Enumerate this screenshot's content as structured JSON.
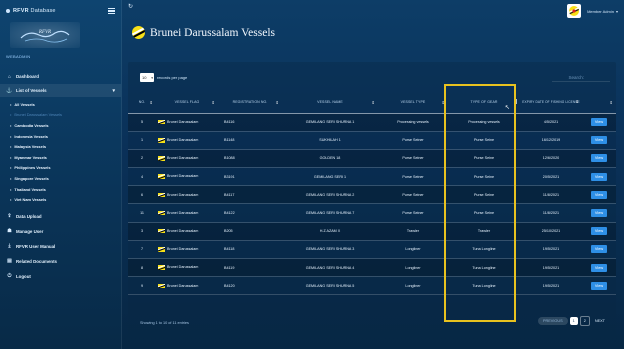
{
  "app": {
    "brand_bold": "RFVR",
    "brand_light": "Database",
    "logo_text": "RFVR",
    "sidebar_user": "WEBADMIN"
  },
  "sidebar": {
    "items": [
      {
        "label": "Dashboard",
        "icon": "home-icon"
      },
      {
        "label": "List of Vessels",
        "icon": "anchor-icon"
      }
    ],
    "sub_items": [
      {
        "label": "All Vessels"
      },
      {
        "label": "Brunei Darussalam Vessels",
        "active": true
      },
      {
        "label": "Cambodia Vessels"
      },
      {
        "label": "Indonesia Vessels"
      },
      {
        "label": "Malaysia Vessels"
      },
      {
        "label": "Myanmar Vessels"
      },
      {
        "label": "Philippines Vessels"
      },
      {
        "label": "Singapore Vessels"
      },
      {
        "label": "Thailand Vessels"
      },
      {
        "label": "Viet Nam Vessels"
      }
    ],
    "bottom_items": [
      {
        "label": "Data Upload",
        "icon": "upload-icon"
      },
      {
        "label": "Manage User",
        "icon": "users-icon"
      },
      {
        "label": "RFVR User Manual",
        "icon": "download-icon"
      },
      {
        "label": "Related Documents",
        "icon": "document-icon"
      },
      {
        "label": "Logout",
        "icon": "power-icon"
      }
    ]
  },
  "header": {
    "title": "Brunei Darussalam Vessels",
    "user_name": "Member Admin"
  },
  "controls": {
    "page_length": "10",
    "length_label": "records per page",
    "search_label": "Search:",
    "search_placeholder": ""
  },
  "table": {
    "columns": [
      "NO.",
      "VESSEL FLAG",
      "REGISTRATION NO.",
      "VESSEL NAME",
      "VESSEL TYPE",
      "TYPE OF GEAR",
      "EXPIRY DATE OF FISHING LICENSE",
      ""
    ],
    "rows": [
      {
        "no": "5",
        "flag": "Brunei Darussalam",
        "reg": "B4116",
        "name": "GEMILANG SERI SHURNA 1",
        "type": "Processing vessels",
        "gear": "Processing vessels",
        "expiry": "4/5/2021",
        "action": "View"
      },
      {
        "no": "1",
        "flag": "Brunei Darussalam",
        "reg": "B1148",
        "name": "SUKHILAH 1",
        "type": "Purse Seiner",
        "gear": "Purse Seine",
        "expiry": "16/12/2019",
        "action": "View"
      },
      {
        "no": "2",
        "flag": "Brunei Darussalam",
        "reg": "B1088",
        "name": "GOLDEN 18",
        "type": "Purse Seiner",
        "gear": "Purse Seine",
        "expiry": "12/6/2020",
        "action": "View"
      },
      {
        "no": "4",
        "flag": "Brunei Darussalam",
        "reg": "B3191",
        "name": "GEMILANG SERI 1",
        "type": "Purse Seiner",
        "gear": "Purse Seine",
        "expiry": "20/5/2021",
        "action": "View"
      },
      {
        "no": "6",
        "flag": "Brunei Darussalam",
        "reg": "B4117",
        "name": "GEMILANG SERI SHURNA 2",
        "type": "Purse Seiner",
        "gear": "Purse Seine",
        "expiry": "11/8/2021",
        "action": "View"
      },
      {
        "no": "11",
        "flag": "Brunei Darussalam",
        "reg": "B4122",
        "name": "GEMILANG SERI SHURNA 7",
        "type": "Purse Seiner",
        "gear": "Purse Seine",
        "expiry": "11/8/2021",
        "action": "View"
      },
      {
        "no": "3",
        "flag": "Brunei Darussalam",
        "reg": "B205",
        "name": "H.Z AZAM X",
        "type": "Trawler",
        "gear": "Trawler",
        "expiry": "25/10/2021",
        "action": "View"
      },
      {
        "no": "7",
        "flag": "Brunei Darussalam",
        "reg": "B4118",
        "name": "GEMILANG SERI SHURNA 3",
        "type": "Longliner",
        "gear": "Tuna Longline",
        "expiry": "19/5/2021",
        "action": "View"
      },
      {
        "no": "8",
        "flag": "Brunei Darussalam",
        "reg": "B4119",
        "name": "GEMILANG SERI SHURNA 4",
        "type": "Longliner",
        "gear": "Tuna Longline",
        "expiry": "19/5/2021",
        "action": "View"
      },
      {
        "no": "9",
        "flag": "Brunei Darussalam",
        "reg": "B4120",
        "name": "GEMILANG SERI SHURNA 5",
        "type": "Longliner",
        "gear": "Tuna Longline",
        "expiry": "19/5/2021",
        "action": "View"
      }
    ]
  },
  "footer": {
    "info": "Showing 1 to 10 of 11 entries",
    "prev": "PREVIOUS",
    "page1": "1",
    "page2": "2",
    "next": "NEXT"
  },
  "colors": {
    "accent": "#2e8fe6",
    "highlight": "#e8c21f",
    "active_nav": "#4e84b7"
  }
}
